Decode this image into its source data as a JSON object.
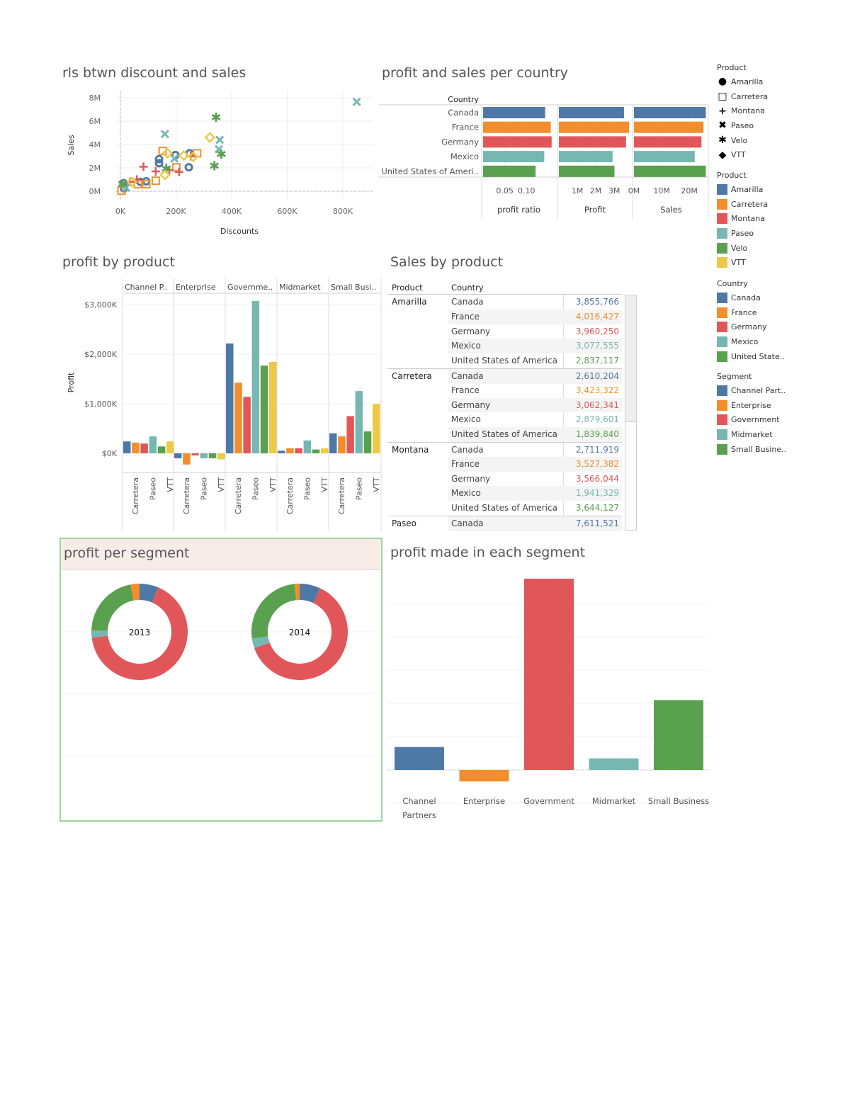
{
  "colors": {
    "blue": "#4e79a7",
    "orange": "#f28e2b",
    "red": "#e15759",
    "teal": "#76b7b2",
    "green": "#59a14f",
    "yellow": "#edc948"
  },
  "legends": {
    "product_shape": {
      "title": "Product",
      "items": [
        {
          "label": "Amarilla",
          "icon": "circle-icon"
        },
        {
          "label": "Carretera",
          "icon": "square-icon"
        },
        {
          "label": "Montana",
          "icon": "plus-icon"
        },
        {
          "label": "Paseo",
          "icon": "x-icon"
        },
        {
          "label": "Velo",
          "icon": "asterisk-icon"
        },
        {
          "label": "VTT",
          "icon": "diamond-icon"
        }
      ]
    },
    "product_color": {
      "title": "Product",
      "items": [
        {
          "label": "Amarilla",
          "color": "#4e79a7"
        },
        {
          "label": "Carretera",
          "color": "#f28e2b"
        },
        {
          "label": "Montana",
          "color": "#e15759"
        },
        {
          "label": "Paseo",
          "color": "#76b7b2"
        },
        {
          "label": "Velo",
          "color": "#59a14f"
        },
        {
          "label": "VTT",
          "color": "#edc948"
        }
      ]
    },
    "country_color": {
      "title": "Country",
      "items": [
        {
          "label": "Canada",
          "color": "#4e79a7"
        },
        {
          "label": "France",
          "color": "#f28e2b"
        },
        {
          "label": "Germany",
          "color": "#e15759"
        },
        {
          "label": "Mexico",
          "color": "#76b7b2"
        },
        {
          "label": "United State..",
          "color": "#59a14f"
        }
      ]
    },
    "segment_color": {
      "title": "Segment",
      "items": [
        {
          "label": "Channel Part..",
          "color": "#4e79a7"
        },
        {
          "label": "Enterprise",
          "color": "#f28e2b"
        },
        {
          "label": "Government",
          "color": "#e15759"
        },
        {
          "label": "Midmarket",
          "color": "#76b7b2"
        },
        {
          "label": "Small Busine..",
          "color": "#59a14f"
        }
      ]
    }
  },
  "chart_data": [
    {
      "type": "scatter",
      "title": "rls btwn discount and sales",
      "xlabel": "Discounts",
      "ylabel": "Sales",
      "xlim": [
        0,
        900000
      ],
      "ylim": [
        0,
        8000000
      ],
      "xticks": [
        "0K",
        "200K",
        "400K",
        "600K",
        "800K"
      ],
      "yticks": [
        "0M",
        "2M",
        "4M",
        "6M",
        "8M"
      ],
      "series": [
        {
          "name": "Amarilla",
          "shape": "circle",
          "color": "#4e79a7",
          "points": [
            [
              198000,
              3100000
            ],
            [
              249000,
              3250000
            ],
            [
              139000,
              2750000
            ],
            [
              139000,
              2400000
            ],
            [
              246000,
              2050000
            ],
            [
              72000,
              800000
            ],
            [
              93000,
              850000
            ],
            [
              11000,
              700000
            ],
            [
              13000,
              250000
            ]
          ]
        },
        {
          "name": "Carretera",
          "shape": "square",
          "color": "#f28e2b",
          "points": [
            [
              152000,
              3450000
            ],
            [
              276000,
              3250000
            ],
            [
              201000,
              2050000
            ],
            [
              127000,
              900000
            ],
            [
              63000,
              600000
            ],
            [
              93000,
              600000
            ],
            [
              4000,
              50000
            ]
          ]
        },
        {
          "name": "Montana",
          "shape": "plus",
          "color": "#e15759",
          "points": [
            [
              83000,
              2100000
            ],
            [
              127000,
              1700000
            ],
            [
              176000,
              1800000
            ],
            [
              211000,
              1650000
            ],
            [
              253000,
              3000000
            ],
            [
              34000,
              800000
            ],
            [
              59000,
              1000000
            ]
          ]
        },
        {
          "name": "Paseo",
          "shape": "x",
          "color": "#76b7b2",
          "points": [
            [
              850000,
              7650000
            ],
            [
              160000,
              4900000
            ],
            [
              357000,
              4400000
            ],
            [
              354000,
              3600000
            ],
            [
              194000,
              2800000
            ],
            [
              20000,
              300000
            ]
          ]
        },
        {
          "name": "Velo",
          "shape": "asterisk",
          "color": "#59a14f",
          "points": [
            [
              344000,
              6300000
            ],
            [
              363000,
              3150000
            ],
            [
              338000,
              2150000
            ],
            [
              165000,
              1900000
            ],
            [
              8000,
              600000
            ]
          ]
        },
        {
          "name": "VTT",
          "shape": "diamond",
          "color": "#edc948",
          "points": [
            [
              322000,
              4600000
            ],
            [
              160000,
              1400000
            ],
            [
              169000,
              3250000
            ],
            [
              228000,
              3050000
            ],
            [
              262000,
              2950000
            ],
            [
              42000,
              800000
            ]
          ]
        }
      ]
    },
    {
      "type": "bar",
      "orientation": "horizontal",
      "title": "profit and sales per country",
      "row_header": "Country",
      "categories": [
        "Canada",
        "France",
        "Germany",
        "Mexico",
        "United States of Ameri.."
      ],
      "panels": [
        {
          "label": "profit ratio",
          "values": [
            0.143,
            0.156,
            0.158,
            0.141,
            0.121
          ],
          "max": 0.16,
          "ticks": [
            {
              "v": 0.05,
              "t": "0.05"
            },
            {
              "v": 0.1,
              "t": "0.10"
            }
          ]
        },
        {
          "label": "Profit",
          "values": [
            3530000,
            3800000,
            3640000,
            2910000,
            3010000
          ],
          "max": 3800000,
          "ticks": [
            {
              "v": 1000000,
              "t": "1M"
            },
            {
              "v": 2000000,
              "t": "2M"
            },
            {
              "v": 3000000,
              "t": "3M"
            }
          ]
        },
        {
          "label": "Sales",
          "values": [
            25960000,
            25100000,
            24400000,
            21960000,
            25960000
          ],
          "max": 26100000,
          "ticks": [
            {
              "v": 0,
              "t": "0M"
            },
            {
              "v": 10000000,
              "t": "10M"
            },
            {
              "v": 20000000,
              "t": "20M"
            }
          ]
        }
      ]
    },
    {
      "type": "bar",
      "title": "profit by product",
      "ylabel": "Profit",
      "ylim": [
        -350000,
        3200000
      ],
      "yticks": [
        {
          "v": 0,
          "t": "$0K"
        },
        {
          "v": 1000000,
          "t": "$1,000K"
        },
        {
          "v": 2000000,
          "t": "$2,000K"
        },
        {
          "v": 3000000,
          "t": "$3,000K"
        }
      ],
      "panels": [
        "Channel P..",
        "Enterprise",
        "Governme..",
        "Midmarket",
        "Small Busi.."
      ],
      "categories": [
        "Amarilla",
        "Carretera",
        "Montana",
        "Paseo",
        "Velo",
        "VTT"
      ],
      "x_tick_labels": [
        "Carretera",
        "Paseo",
        "VTT"
      ],
      "values": [
        [
          240000,
          216000,
          197000,
          341000,
          139000,
          240000
        ],
        [
          -101000,
          -226000,
          -43000,
          -101000,
          -101000,
          -120000
        ],
        [
          2216000,
          1423000,
          1139000,
          3072000,
          1769000,
          1846000
        ],
        [
          53000,
          101000,
          101000,
          260000,
          77000,
          101000
        ],
        [
          404000,
          341000,
          750000,
          1255000,
          442000,
          995000
        ]
      ]
    },
    {
      "type": "table",
      "title": "Sales by product",
      "columns": [
        "Product",
        "Country"
      ],
      "rows": [
        [
          "Amarilla",
          "Canada",
          "3,855,766"
        ],
        [
          "",
          "France",
          "4,016,427"
        ],
        [
          "",
          "Germany",
          "3,960,250"
        ],
        [
          "",
          "Mexico",
          "3,077,555"
        ],
        [
          "",
          "United States of America",
          "2,837,117"
        ],
        [
          "Carretera",
          "Canada",
          "2,610,204"
        ],
        [
          "",
          "France",
          "3,423,322"
        ],
        [
          "",
          "Germany",
          "3,062,341"
        ],
        [
          "",
          "Mexico",
          "2,879,601"
        ],
        [
          "",
          "United States of America",
          "1,839,840"
        ],
        [
          "Montana",
          "Canada",
          "2,711,919"
        ],
        [
          "",
          "France",
          "3,527,382"
        ],
        [
          "",
          "Germany",
          "3,566,044"
        ],
        [
          "",
          "Mexico",
          "1,941,329"
        ],
        [
          "",
          "United States of America",
          "3,644,127"
        ],
        [
          "Paseo",
          "Canada",
          "7,611,521"
        ]
      ]
    },
    {
      "type": "pie",
      "title": "profit per segment",
      "donut": true,
      "categories": [
        "Channel Partners",
        "Government",
        "Midmarket",
        "Small Business",
        "Enterprise"
      ],
      "charts": [
        {
          "label": "2013",
          "values": [
            6.3,
            66.7,
            2.5,
            21.5,
            3.0
          ]
        },
        {
          "label": "2014",
          "values": [
            7.0,
            62.5,
            3.3,
            25.5,
            1.7
          ]
        }
      ]
    },
    {
      "type": "bar",
      "title": "profit made in each segment",
      "categories": [
        "Channel Partners",
        "Enterprise",
        "Government",
        "Midmarket",
        "Small Business"
      ],
      "values": [
        1373000,
        -692000,
        11465000,
        693000,
        4187000
      ]
    }
  ]
}
